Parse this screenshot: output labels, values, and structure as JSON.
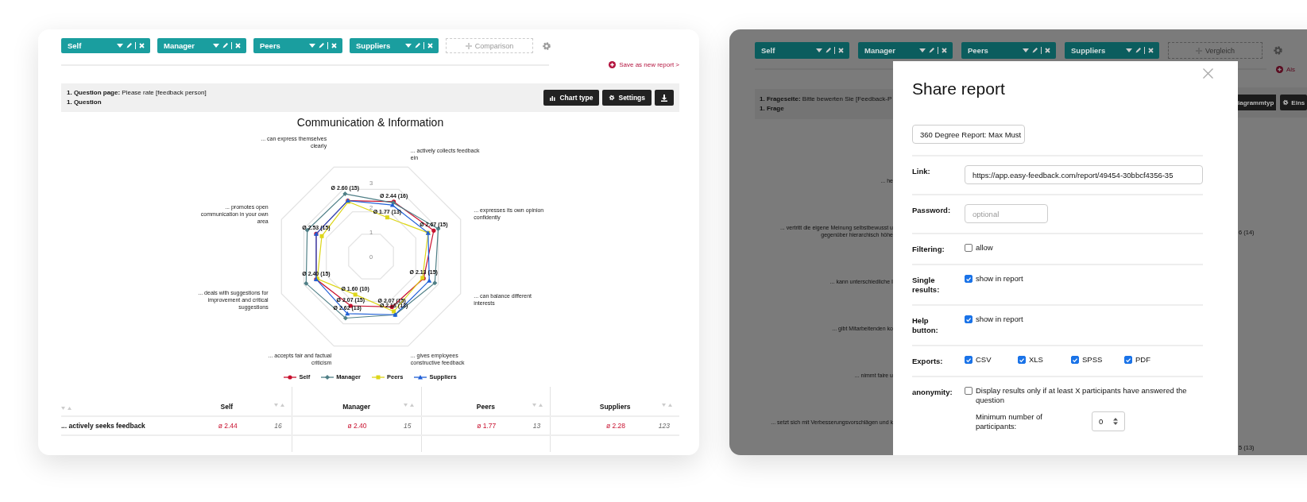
{
  "left_report": {
    "filter_tabs": [
      {
        "label": "Self"
      },
      {
        "label": "Manager"
      },
      {
        "label": "Peers"
      },
      {
        "label": "Suppliers"
      }
    ],
    "comparison_button": "Comparison",
    "save_link": "Save as new report >",
    "question": {
      "page_label": "1. Question page:",
      "page_text": "Please rate [feedback person]",
      "question": "1. Question"
    },
    "buttons": [
      {
        "kind": "chart",
        "label": "Chart type"
      },
      {
        "kind": "settings",
        "label": "Settings"
      },
      {
        "kind": "download"
      }
    ],
    "radar_chart": {
      "title": "Communication & Information",
      "axes": [
        "... can express themselves clearly",
        "... actively collects feedback ein",
        "... promotes open communication in your own area",
        "... expresses its own opinion confidently",
        "... deals with suggestions for improvement and critical suggestions",
        "... can balance different interests",
        "... accepts fair and factual criticism",
        "... gives employees constructive feedback"
      ],
      "ticks": [
        "3",
        "2",
        "1",
        "0"
      ],
      "series": [
        {
          "name": "Self",
          "color": "#c8102e",
          "kind": "circle"
        },
        {
          "name": "Manager",
          "color": "#4f7f86",
          "kind": "diamond"
        },
        {
          "name": "Peers",
          "color": "#ddd61a",
          "kind": "square"
        },
        {
          "name": "Suppliers",
          "color": "#1f5fd6",
          "kind": "triangle"
        }
      ],
      "data_labels": [
        "Ø 2.60 (15)",
        "Ø 2.44 (16)",
        "Ø 1.77 (13)",
        "Ø 2.67 (15)",
        "Ø 2.13 (15)",
        "Ø 2.07 (15)",
        "Ø 2.18 (13)",
        "Ø 1.60 (10)",
        "Ø 2.07 (15)",
        "Ø 2.62 (13)",
        "Ø 2.40 (15)",
        "Ø 2.53 (15)"
      ]
    },
    "table": {
      "columns": [
        "Self",
        "Manager",
        "Peers",
        "Suppliers"
      ],
      "rows": [
        {
          "label": "... actively seeks feedback",
          "cells": [
            {
              "mean": "ø 2.44",
              "count": "16"
            },
            {
              "mean": "ø 2.40",
              "count": "15"
            },
            {
              "mean": "ø 1.77",
              "count": "13"
            },
            {
              "mean": "ø 2.28",
              "count": "123"
            }
          ]
        }
      ]
    }
  },
  "right_report": {
    "filter_tabs": [
      {
        "label": "Self"
      },
      {
        "label": "Manager"
      },
      {
        "label": "Peers"
      },
      {
        "label": "Suppliers"
      }
    ],
    "comparison_button": "Vergleich",
    "save_link": "Als",
    "question": {
      "page_label": "1. Frageseite:",
      "page_text": "Bitte bewerten Sie [Feedback-P",
      "question": "1. Frage"
    },
    "buttons": [
      {
        "kind": "text",
        "label": "iagrammtyp"
      },
      {
        "kind": "settings",
        "label": "Eins"
      }
    ],
    "chart_labels_left": [
      [
        "... he"
      ],
      [
        "... vertritt die eigene Meinung selbstbewusst u",
        "gegenüber hierarchisch höhe"
      ],
      [
        "... kann unterschiedliche I"
      ],
      [
        "... gibt Mitarbeitenden ko"
      ],
      [
        "... nimmt faire u"
      ],
      [
        "... setzt sich mit Verbesserungsvorschlägen und k"
      ]
    ],
    "chart_labels_right": [
      "6 (14)",
      "5 (13)"
    ]
  },
  "share_dialog": {
    "title": "Share report",
    "report_name": "360 Degree Report: Max Must",
    "rows": [
      {
        "kind": "input",
        "label": "Link:",
        "value": "https://app.easy-feedback.com/report/49454-30bbcf4356-35"
      },
      {
        "kind": "password",
        "label": "Password:",
        "placeholder": "optional"
      },
      {
        "kind": "checks",
        "label": "Filtering:",
        "options": [
          {
            "label": "allow",
            "checked": false
          }
        ]
      },
      {
        "kind": "checks",
        "label": "Single results:",
        "options": [
          {
            "label": "show in report",
            "checked": true
          }
        ]
      },
      {
        "kind": "checks",
        "label": "Help button:",
        "options": [
          {
            "label": "show in report",
            "checked": true
          }
        ]
      },
      {
        "kind": "checks",
        "label": "Exports:",
        "options": [
          {
            "label": "CSV",
            "checked": true
          },
          {
            "label": "XLS",
            "checked": true
          },
          {
            "label": "SPSS",
            "checked": true
          },
          {
            "label": "PDF",
            "checked": true
          }
        ]
      },
      {
        "kind": "anonymity",
        "label": "anonymity:",
        "options": [
          {
            "label": "Display results only if at least X participants have answered the question",
            "checked": false
          }
        ],
        "min_label": "Minimum number of participants:",
        "min_value": "0"
      }
    ]
  }
}
